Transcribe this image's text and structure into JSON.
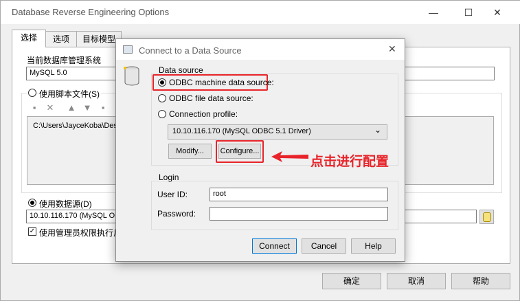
{
  "outer_window": {
    "title": "Database Reverse Engineering Options",
    "controls": {
      "minimize": "—",
      "maximize": "☐",
      "close": "✕"
    },
    "tabs": [
      "选择",
      "选项",
      "目标模型"
    ],
    "dbms_label": "当前数据库管理系统",
    "dbms_value": "MySQL 5.0",
    "use_script_label": "使用脚本文件(S)",
    "script_file_path": "C:\\Users\\JayceKoba\\Des",
    "use_datasource_label": "使用数据源(D)",
    "datasource_value": "10.10.116.170 (MySQL OD",
    "admin_checkbox_label": "使用管理员权限执行反",
    "buttons": {
      "ok": "确定",
      "cancel": "取消",
      "help": "帮助"
    }
  },
  "dialog": {
    "title": "Connect to a Data Source",
    "close": "✕",
    "data_source_group": "Data source",
    "options": {
      "odbc_machine": "ODBC machine data source:",
      "odbc_file": "ODBC file data source:",
      "connection_profile": "Connection profile:"
    },
    "selected_source": "10.10.116.170 (MySQL ODBC 5.1 Driver)",
    "modify_button": "Modify...",
    "configure_button": "Configure...",
    "login_group": "Login",
    "user_id_label": "User ID:",
    "user_id_value": "root",
    "password_label": "Password:",
    "password_value": "",
    "buttons": {
      "connect": "Connect",
      "cancel": "Cancel",
      "help": "Help"
    }
  },
  "annotation": {
    "text": "点击进行配置",
    "color": "#e8242a"
  }
}
